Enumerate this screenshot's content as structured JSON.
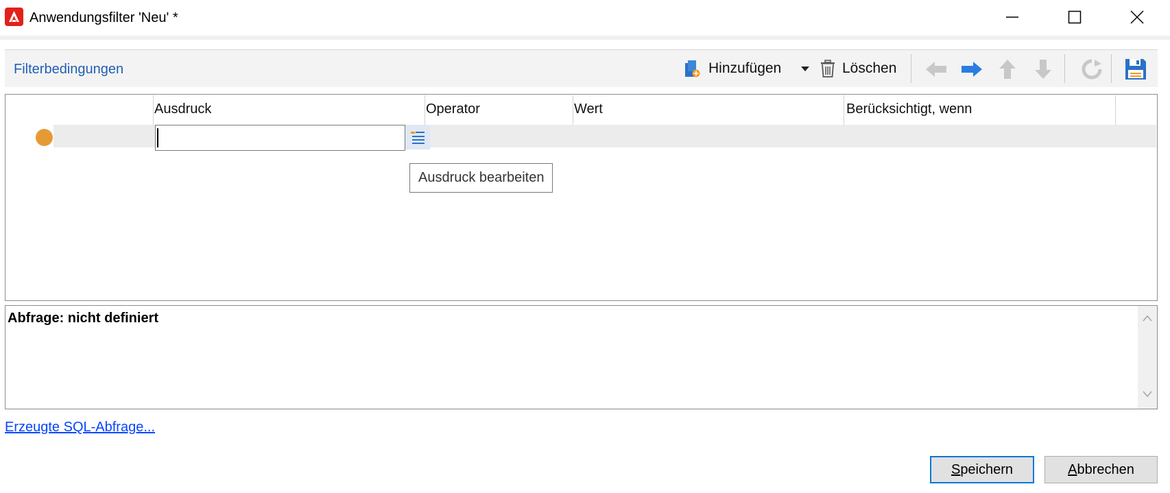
{
  "window": {
    "title": "Anwendungsfilter 'Neu' *",
    "app_icon": "adobe-campaign-icon",
    "controls": [
      "minimize-icon",
      "maximize-icon",
      "close-icon"
    ]
  },
  "section": {
    "title": "Filterbedingungen"
  },
  "toolbar": {
    "add_label": "Hinzufügen",
    "delete_label": "Löschen",
    "icons": [
      "add-icon",
      "dropdown-caret-icon",
      "trash-icon",
      "arrow-left-icon",
      "arrow-right-icon",
      "arrow-up-icon",
      "arrow-down-icon",
      "refresh-icon",
      "save-icon"
    ]
  },
  "grid": {
    "columns": [
      "Ausdruck",
      "Operator",
      "Wert",
      "Berücksichtigt, wenn"
    ],
    "rows": [
      {
        "status_color": "#e69a36",
        "expression": "",
        "operator": "",
        "value": "",
        "condition": ""
      }
    ],
    "tooltip": "Ausdruck bearbeiten"
  },
  "query": {
    "text": "Abfrage: nicht definiert"
  },
  "link": {
    "sql": "Erzeugte SQL-Abfrage..."
  },
  "buttons": {
    "save_first": "S",
    "save_rest": "peichern",
    "cancel_first": "A",
    "cancel_rest": "bbrechen"
  },
  "colors": {
    "accent": "#1f5fb4",
    "link": "#0645ff",
    "logo": "#e3201b",
    "status_dot": "#e69a36",
    "focus": "#0078d7"
  }
}
